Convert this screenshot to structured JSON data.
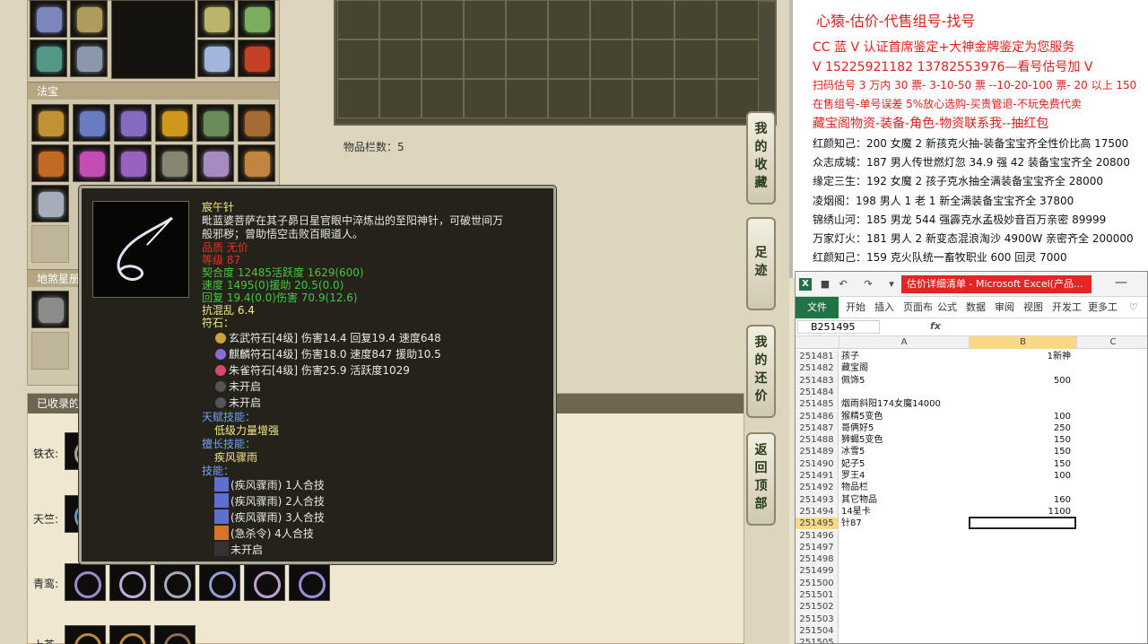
{
  "game": {
    "fabao_title": "法宝",
    "dishageng_title": "地煞星册",
    "bag_count": "物品栏数：5",
    "side_buttons": [
      {
        "chars": [
          "我",
          "的",
          "收",
          "藏"
        ]
      },
      {
        "chars": [
          "足",
          "迹"
        ]
      },
      {
        "chars": [
          "我",
          "的",
          "还",
          "价"
        ]
      },
      {
        "chars": [
          "返",
          "回",
          "顶",
          "部"
        ]
      }
    ],
    "recorded_title": "已收录的",
    "rows": [
      "铁衣:",
      "天竺:",
      "青鸾:",
      "上苍"
    ]
  },
  "tooltip": {
    "name": "宸午针",
    "desc1": "毗蓝婆菩萨在其子昴日星官眼中淬炼出的至阳神针，可破世间万",
    "desc2": "般邪秽；曾助悟空击败百眼道人。",
    "quality": "品质  无价",
    "level": "等级  87",
    "stat1": "契合度     12485活跃度   1629(600)",
    "stat2": "速度       1495(0)援助     20.5(0.0)",
    "stat3": "回复       19.4(0.0)伤害    70.9(12.6)",
    "stat4": "抗混乱 6.4",
    "runes_label": "符石：",
    "runes": [
      "玄武符石[4级] 伤害14.4 回复19.4 速度648",
      "麒麟符石[4级] 伤害18.0 速度847 援助10.5",
      "朱雀符石[4级] 伤害25.9 活跃度1029",
      "未开启",
      "未开启"
    ],
    "talent_label": "天赋技能：",
    "talent": "低级力量增强",
    "good_label": "擅长技能：",
    "good": "疾风骤雨",
    "skills_label": "技能：",
    "skills": [
      "(疾风骤雨) 1人合技",
      "(疾风骤雨) 2人合技",
      "(疾风骤雨) 3人合技",
      "(急杀令) 4人合技",
      "未开启"
    ]
  },
  "notes": {
    "title": "心猿-估价-代售组号-找号",
    "line1": "CC 蓝 V 认证首席鉴定+大神金牌鉴定为您服务",
    "line2": "V 15225921182      13782553976—看号估号加 V",
    "line3": "扫码估号 3 万内 30 票- 3-10-50 票  --10-20-100 票- 20 以上 150",
    "line4": "在售组号-单号误差 5%放心选购-买贵管退-不玩免费代卖",
    "line5": "藏宝阁物资-装备-角色-物资联系我--抽红包",
    "items": [
      "红颜知己：200 女魔 2 新孩克火抽-装备宝宝齐全性价比高 17500",
      "众志成城：187 男人传世燃灯忽 34.9 强 42 装备宝宝齐全 20800",
      "缘定三生：192 女魔 2 孩子克水抽全满装备宝宝齐全 28000",
      "凌烟阁：198 男人 1 老 1 新全满装备宝宝齐全 37800",
      "锦绣山河：185 男龙 544 强霹克水孟极妙音百万亲密 89999",
      "万家灯火：181 男人 2 新变态混浪淘沙 4900W 亲密齐全 200000",
      "红颜知己：159 克火队统一畜牧职业 600 回灵 7000"
    ]
  },
  "excel": {
    "caption": "估价详细清单 - Microsoft Excel(产品...",
    "tabs": [
      "开始",
      "插入",
      "页面布",
      "公式",
      "数据",
      "审阅",
      "视图",
      "开发工",
      "更多工"
    ],
    "file_tab": "文件",
    "cell_ref": "B251495",
    "fx": "fx",
    "col_a": "A",
    "col_b": "B",
    "col_c": "C",
    "rows": [
      {
        "n": "251481",
        "a": "孩子",
        "b": "1新神"
      },
      {
        "n": "251482",
        "a": "藏宝阁",
        "b": ""
      },
      {
        "n": "251483",
        "a": "佩饰5",
        "b": "500"
      },
      {
        "n": "251484",
        "a": "",
        "b": ""
      },
      {
        "n": "251485",
        "a": "烟雨斜阳174女魔14000",
        "b": ""
      },
      {
        "n": "251486",
        "a": "猴精5变色",
        "b": "100"
      },
      {
        "n": "251487",
        "a": "哥俩好5",
        "b": "250"
      },
      {
        "n": "251488",
        "a": "狮蝎5变色",
        "b": "150"
      },
      {
        "n": "251489",
        "a": "冰雪5",
        "b": "150"
      },
      {
        "n": "251490",
        "a": "妃子5",
        "b": "150"
      },
      {
        "n": "251491",
        "a": "罗王4",
        "b": "100"
      },
      {
        "n": "251492",
        "a": "物品栏",
        "b": ""
      },
      {
        "n": "251493",
        "a": "其它物品",
        "b": "160"
      },
      {
        "n": "251494",
        "a": "14星卡",
        "b": "1100"
      },
      {
        "n": "251495",
        "a": "针87",
        "b": ""
      },
      {
        "n": "251496",
        "a": "",
        "b": ""
      },
      {
        "n": "251497",
        "a": "",
        "b": ""
      },
      {
        "n": "251498",
        "a": "",
        "b": ""
      },
      {
        "n": "251499",
        "a": "",
        "b": ""
      },
      {
        "n": "251500",
        "a": "",
        "b": ""
      },
      {
        "n": "251501",
        "a": "",
        "b": ""
      },
      {
        "n": "251502",
        "a": "",
        "b": ""
      },
      {
        "n": "251503",
        "a": "",
        "b": ""
      },
      {
        "n": "251504",
        "a": "",
        "b": ""
      },
      {
        "n": "251505",
        "a": "",
        "b": ""
      }
    ]
  }
}
